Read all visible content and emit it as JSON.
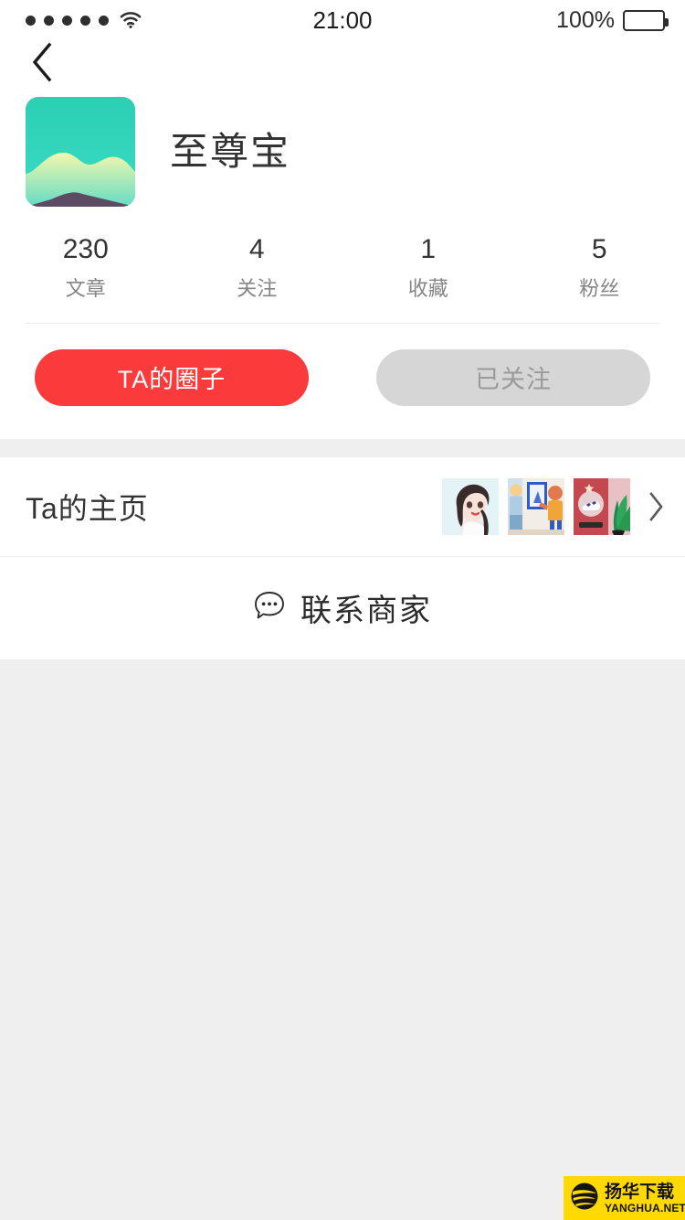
{
  "status_bar": {
    "signal_dots": 5,
    "wifi_icon": "wifi-icon",
    "time": "21:00",
    "battery_percent": "100%",
    "battery_level": 100
  },
  "nav": {
    "back_icon": "chevron-left-icon"
  },
  "profile": {
    "avatar_icon": "landscape-avatar",
    "avatar_colors": {
      "sky_top": "#2fd0b4",
      "sky_bottom": "#3ad9c4",
      "hill": "#eaf5a8",
      "mountain": "#5d4a63"
    },
    "username": "至尊宝",
    "stats": [
      {
        "value": "230",
        "label": "文章"
      },
      {
        "value": "4",
        "label": "关注"
      },
      {
        "value": "1",
        "label": "收藏"
      },
      {
        "value": "5",
        "label": "粉丝"
      }
    ],
    "buttons": {
      "primary_label": "TA的圈子",
      "primary_color": "#fb3b3b",
      "secondary_label": "已关注",
      "secondary_color": "#d6d6d6",
      "secondary_text_color": "#9a9a9a"
    }
  },
  "homepage_row": {
    "title": "Ta的主页",
    "thumbnails": [
      {
        "name": "thumb-girl-illustration"
      },
      {
        "name": "thumb-gallery-cartoon"
      },
      {
        "name": "thumb-shoe-vending-plant"
      }
    ],
    "chevron_icon": "chevron-right-icon"
  },
  "contact_row": {
    "icon": "chat-bubble-icon",
    "label": "联系商家"
  },
  "watermark": {
    "cn": "扬华下载",
    "en": "YANGHUA.NET",
    "bg_color": "#ffd900"
  }
}
